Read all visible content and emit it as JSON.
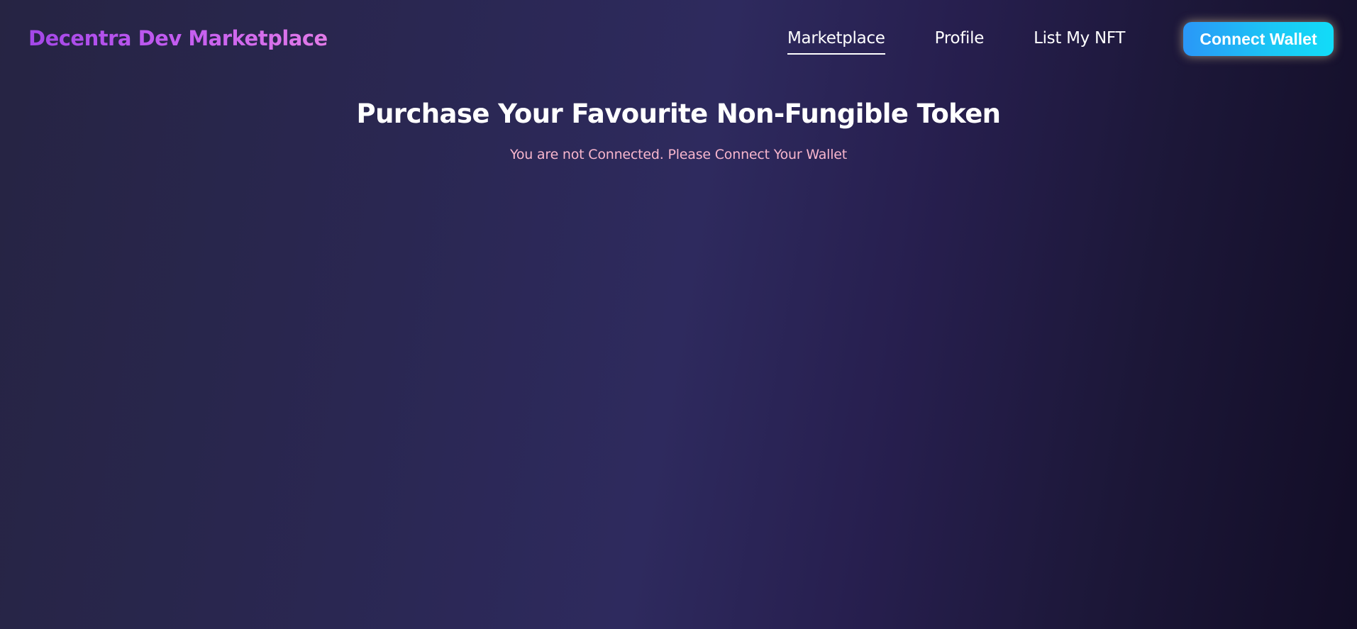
{
  "header": {
    "brand": "Decentra Dev Marketplace",
    "nav": [
      {
        "label": "Marketplace",
        "active": true
      },
      {
        "label": "Profile",
        "active": false
      },
      {
        "label": "List My NFT",
        "active": false
      }
    ],
    "connect_button_label": "Connect Wallet"
  },
  "main": {
    "title": "Purchase Your Favourite Non-Fungible Token",
    "status_message": "You are not Connected. Please Connect Your Wallet"
  },
  "colors": {
    "brand_gradient_start": "#a347e8",
    "brand_gradient_end": "#e27be8",
    "button_gradient_start": "#2a97f7",
    "button_gradient_end": "#12dcf8",
    "status_message": "#f8b6cd",
    "background_dark": "#120d26",
    "background_mid": "#2e2a5e"
  }
}
